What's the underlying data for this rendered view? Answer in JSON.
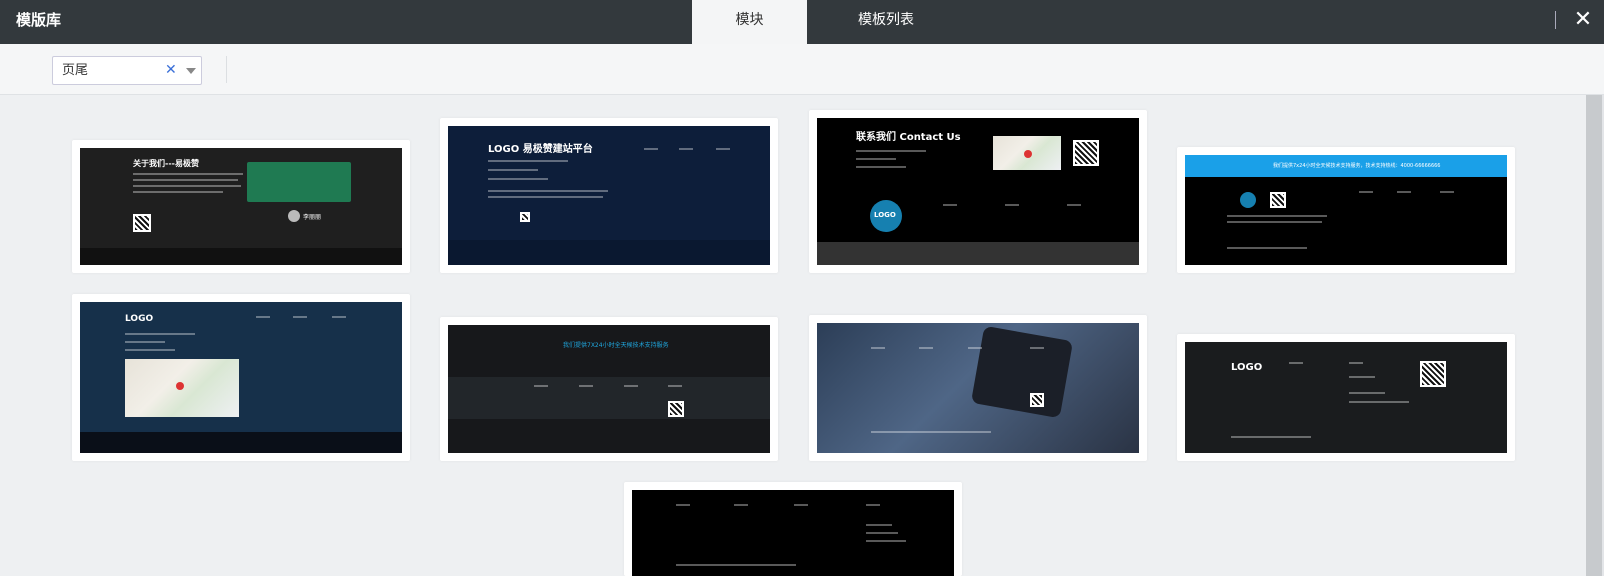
{
  "header": {
    "app_title": "模版库",
    "tabs": [
      {
        "label": "模块",
        "active": true
      },
      {
        "label": "模板列表",
        "active": false
      }
    ],
    "close_icon": "close-icon"
  },
  "filter": {
    "category_value": "页尾",
    "clear_icon": "clear-x-icon",
    "dropdown_icon": "chevron-down-icon"
  },
  "templates": [
    {
      "id": "t1",
      "heading": "关于我们---易极赞",
      "author": "李丽丽",
      "bg": "#1f1f1f",
      "accent": "#1f7a52"
    },
    {
      "id": "t2",
      "heading": "LOGO 易极赞建站平台",
      "bg": "#0d1e3a"
    },
    {
      "id": "t3",
      "heading": "联系我们 Contact Us",
      "logo": "LOGO",
      "bg": "#000000",
      "accent": "#1aa0d8"
    },
    {
      "id": "t4",
      "heading": "我们提供7x24小时全天候技术支持服务，技术支持热线：4000-66666666",
      "bg": "#000000",
      "accent": "#1aa0e8"
    },
    {
      "id": "t5",
      "heading": "LOGO",
      "bg": "#16304a"
    },
    {
      "id": "t6",
      "heading": "我们提供7X24小时全天候技术支持服务",
      "bg": "#17181b",
      "accent": "#1fa8e0"
    },
    {
      "id": "t7",
      "heading": "",
      "bg": "#3a4f6a"
    },
    {
      "id": "t8",
      "heading": "LOGO",
      "bg": "#1a1c1e"
    },
    {
      "id": "t9",
      "heading": "",
      "bg": "#000000"
    }
  ]
}
